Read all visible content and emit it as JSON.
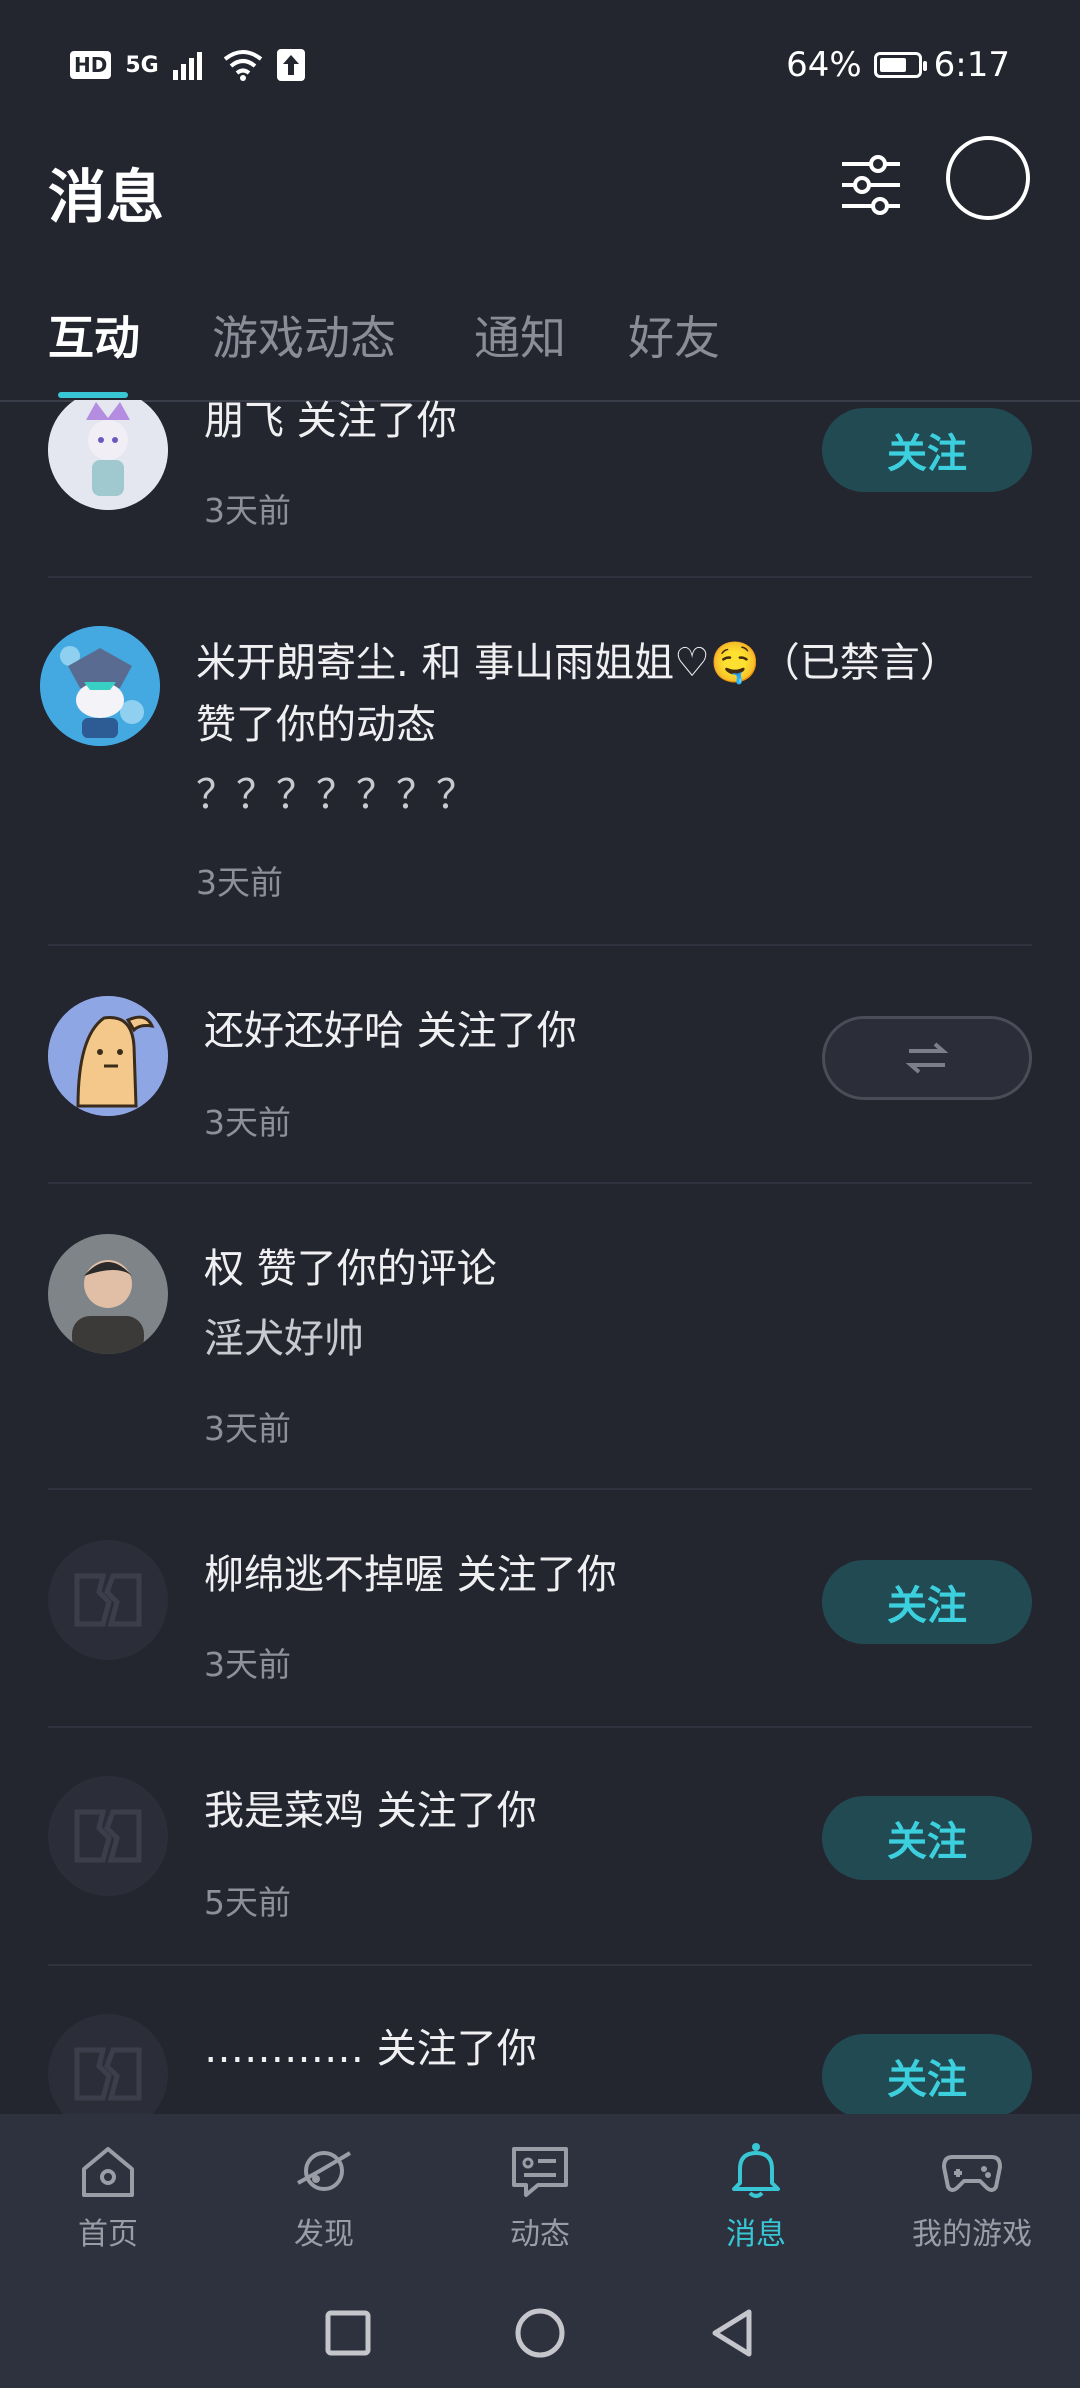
{
  "status_bar": {
    "hd": "HD",
    "network": "5G",
    "battery": "64%",
    "time": "6:17"
  },
  "header": {
    "title": "消息"
  },
  "tabs": [
    {
      "label": "互动"
    },
    {
      "label": "游戏动态"
    },
    {
      "label": "通知"
    },
    {
      "label": "好友"
    }
  ],
  "items": [
    {
      "title": "朋飞 关注了你",
      "time": "3天前",
      "button": "关注"
    },
    {
      "title": "米开朗寄尘. 和 事山雨姐姐♡🤤（已禁言）",
      "title2": "赞了你的动态",
      "content": "？？？？？？？",
      "time": "3天前"
    },
    {
      "title": "还好还好哈 关注了你",
      "time": "3天前"
    },
    {
      "title": "权 赞了你的评论",
      "content": "淫犬好帅",
      "time": "3天前"
    },
    {
      "title": "柳绵逃不掉喔 关注了你",
      "time": "3天前",
      "button": "关注"
    },
    {
      "title": "我是菜鸡 关注了你",
      "time": "5天前",
      "button": "关注"
    },
    {
      "title": "………… 关注了你",
      "button": "关注"
    }
  ],
  "bottom_nav": [
    {
      "label": "首页",
      "icon": "home-icon"
    },
    {
      "label": "发现",
      "icon": "planet-icon"
    },
    {
      "label": "动态",
      "icon": "chat-card-icon"
    },
    {
      "label": "消息",
      "icon": "bell-icon"
    },
    {
      "label": "我的游戏",
      "icon": "gamepad-icon"
    }
  ],
  "colors": {
    "background": "#23252f",
    "accent": "#38c6d4",
    "follow_bg": "#214a52"
  }
}
